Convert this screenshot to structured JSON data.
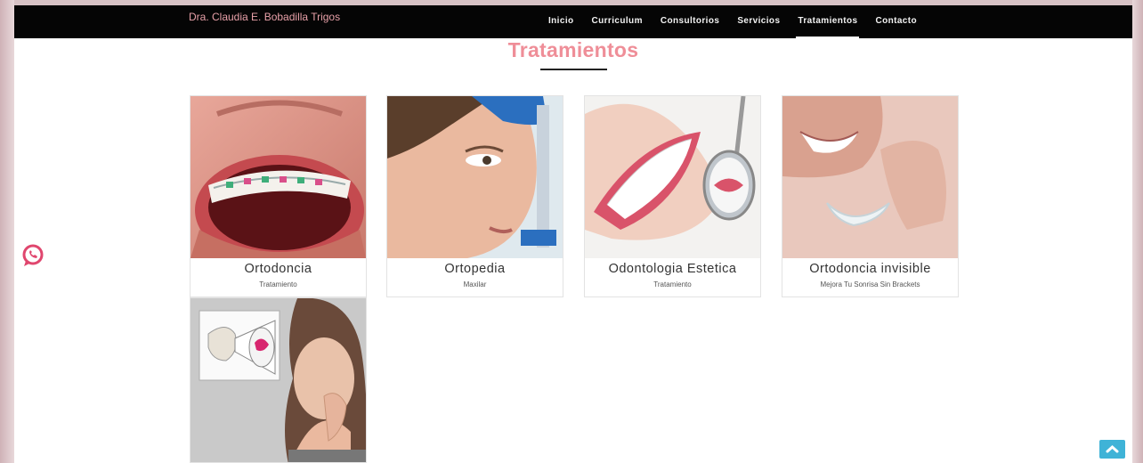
{
  "brand": "Dra. Claudia E. Bobadilla Trigos",
  "nav": [
    "Inicio",
    "Curriculum",
    "Consultorios",
    "Servicios",
    "Tratamientos",
    "Contacto"
  ],
  "active_nav": "Tratamientos",
  "section_title": "Tratamientos",
  "cards": [
    {
      "title": "Ortodoncia",
      "subtitle": "Tratamiento"
    },
    {
      "title": "Ortopedia",
      "subtitle": "Maxilar"
    },
    {
      "title": "Odontologia Estetica",
      "subtitle": "Tratamiento"
    },
    {
      "title": "Ortodoncia invisible",
      "subtitle": "Mejora Tu Sonrisa Sin Brackets"
    }
  ],
  "icons": {
    "whatsapp": "whatsapp-icon",
    "scroll_top": "chevron-up-icon"
  },
  "colors": {
    "accent_pink": "#ef8e98",
    "navbar": "#050505",
    "scroll_top": "#3fb3d7"
  }
}
